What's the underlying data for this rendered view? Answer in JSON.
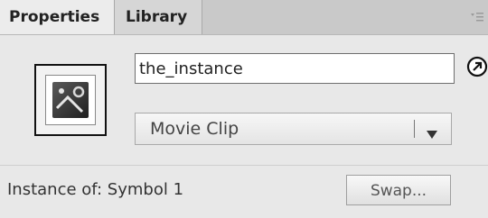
{
  "tabs": [
    {
      "label": "Properties"
    },
    {
      "label": "Library"
    }
  ],
  "instance": {
    "name_value": "the_instance",
    "symbol_type": "Movie Clip",
    "instance_of_label": "Instance of:",
    "symbol_name": "Symbol 1",
    "swap_label": "Swap..."
  },
  "icons": {
    "panel_menu": "panel-menu-icon",
    "symbol": "movie-clip-symbol-icon",
    "edit": "edit-symbol-icon",
    "dropdown": "chevron-down-icon"
  }
}
